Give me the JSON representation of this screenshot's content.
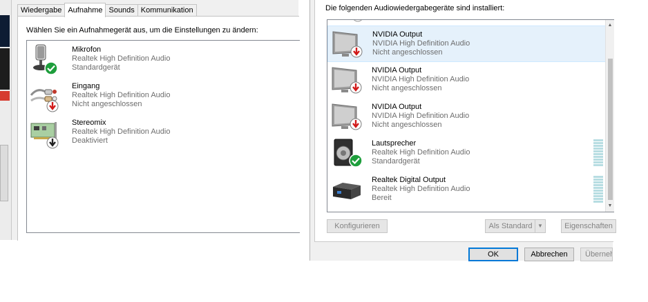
{
  "left_dialog": {
    "tabs": [
      "Wiedergabe",
      "Aufnahme",
      "Sounds",
      "Kommunikation"
    ],
    "active_tab": "Aufnahme",
    "instruction": "Wählen Sie ein Aufnahmegerät aus, um die Einstellungen zu ändern:",
    "devices": [
      {
        "name": "Mikrofon",
        "driver": "Realtek High Definition Audio",
        "status": "Standardgerät",
        "icon": "microphone-icon",
        "badge": "default-check"
      },
      {
        "name": "Eingang",
        "driver": "Realtek High Definition Audio",
        "status": "Nicht angeschlossen",
        "icon": "line-in-cable-icon",
        "badge": "unplugged-red-arrow"
      },
      {
        "name": "Stereomix",
        "driver": "Realtek High Definition Audio",
        "status": "Deaktiviert",
        "icon": "sound-card-icon",
        "badge": "disabled-black-arrow"
      }
    ]
  },
  "right_dialog": {
    "heading": "Die folgenden Audiowiedergabegeräte sind installiert:",
    "devices": [
      {
        "name": "NVIDIA Output",
        "driver": "NVIDIA High Definition Audio",
        "status": "Nicht angeschlossen",
        "icon": "monitor-icon",
        "badge": "unplugged-red-arrow",
        "selected": true
      },
      {
        "name": "NVIDIA Output",
        "driver": "NVIDIA High Definition Audio",
        "status": "Nicht angeschlossen",
        "icon": "monitor-icon",
        "badge": "unplugged-red-arrow"
      },
      {
        "name": "NVIDIA Output",
        "driver": "NVIDIA High Definition Audio",
        "status": "Nicht angeschlossen",
        "icon": "monitor-icon",
        "badge": "unplugged-red-arrow"
      },
      {
        "name": "Lautsprecher",
        "driver": "Realtek High Definition Audio",
        "status": "Standardgerät",
        "icon": "speaker-icon",
        "badge": "default-check"
      },
      {
        "name": "Realtek Digital Output",
        "driver": "Realtek High Definition Audio",
        "status": "Bereit",
        "icon": "digital-output-icon",
        "badge": "none"
      }
    ],
    "buttons": {
      "configure": "Konfigurieren",
      "set_default": "Als Standard",
      "properties": "Eigenschaften",
      "ok": "OK",
      "cancel": "Abbrechen",
      "apply": "Übernehmen"
    }
  },
  "colors": {
    "selection": "#e5f1fb",
    "check_green": "#1e9e3c",
    "unplugged_red": "#d11a1a",
    "vu_meter": "#b7dde2",
    "ok_border": "#0078d7"
  }
}
